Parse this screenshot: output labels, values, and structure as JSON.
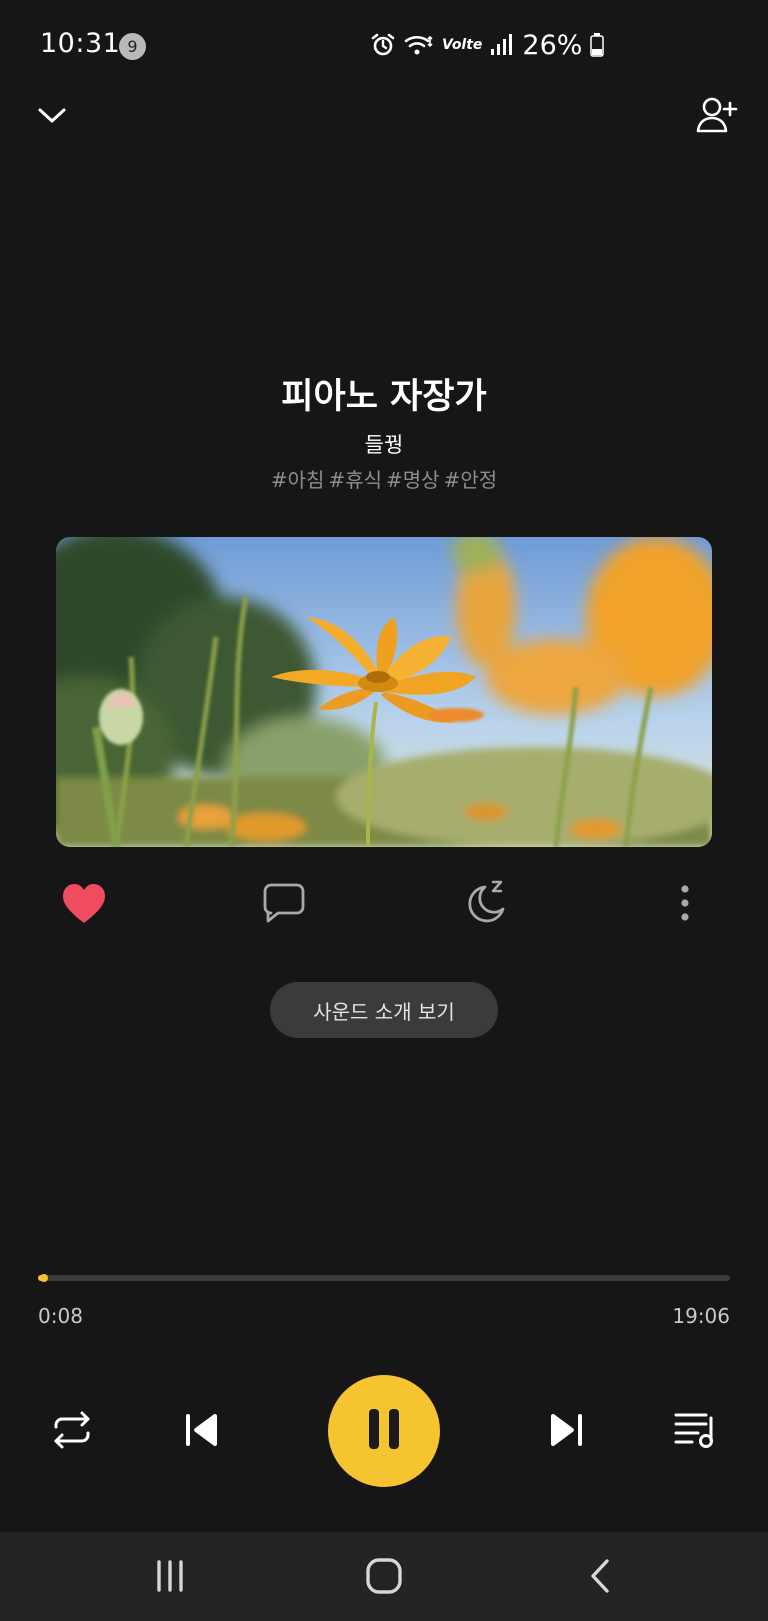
{
  "status_bar": {
    "time": "10:31",
    "notification_count": "9",
    "network": "Volte",
    "battery": "26%"
  },
  "track": {
    "title": "피아노 자장가",
    "artist": "들꿩",
    "tags": [
      "#아침",
      "#휴식",
      "#명상",
      "#안정"
    ]
  },
  "actions": {
    "liked": true,
    "like_color": "#ef4d5f",
    "sound_intro_label": "사운드 소개 보기"
  },
  "playback": {
    "current_time": "0:08",
    "total_time": "19:06",
    "progress": 0.007,
    "accent_color": "#f6c431",
    "state": "playing"
  },
  "icons": [
    "chevron-down-icon",
    "add-person-icon",
    "heart-icon",
    "comment-icon",
    "sleep-timer-icon",
    "more-vert-icon",
    "repeat-icon",
    "previous-icon",
    "pause-icon",
    "next-icon",
    "playlist-icon",
    "recent-apps-icon",
    "home-icon",
    "back-icon"
  ]
}
